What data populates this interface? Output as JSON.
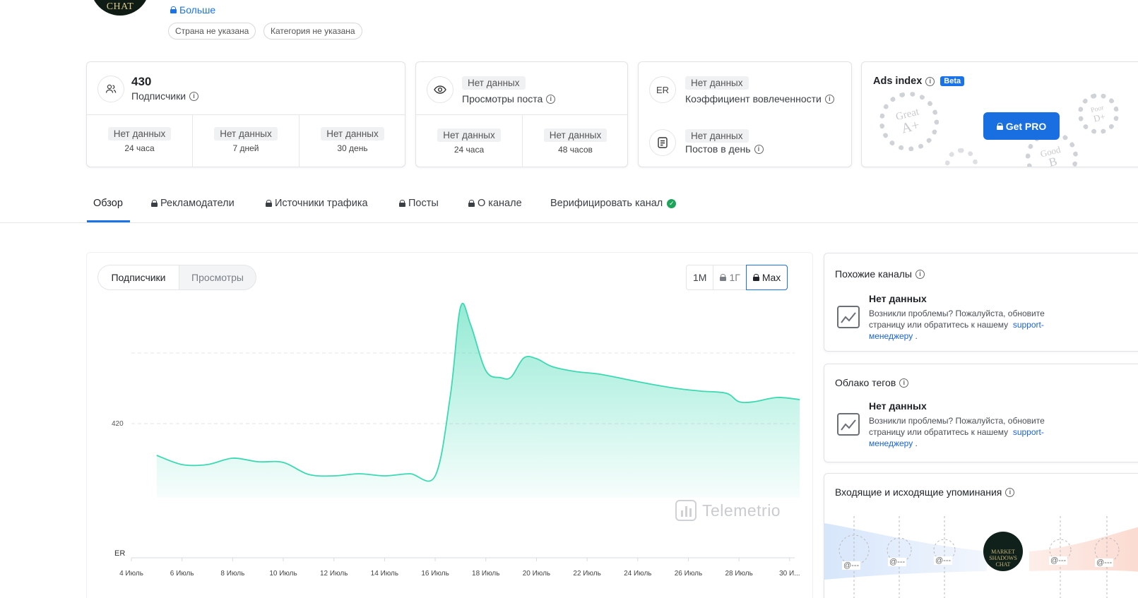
{
  "header": {
    "avatar_text": "CHAT",
    "more_link": "Больше",
    "tags": [
      "Страна не указана",
      "Категория не указана"
    ]
  },
  "subscribers_card": {
    "value": "430",
    "label": "Подписчики",
    "periods": [
      {
        "value": "Нет данных",
        "label": "24 часа"
      },
      {
        "value": "Нет данных",
        "label": "7 дней"
      },
      {
        "value": "Нет данных",
        "label": "30 день"
      }
    ]
  },
  "views_card": {
    "value": "Нет данных",
    "label": "Просмотры поста",
    "periods": [
      {
        "value": "Нет данных",
        "label": "24 часа"
      },
      {
        "value": "Нет данных",
        "label": "48 часов"
      }
    ]
  },
  "engagement_card": {
    "er_icon_text": "ER",
    "er_value": "Нет данных",
    "er_label": "Коэффициент вовлеченности",
    "posts_value": "Нет данных",
    "posts_label": "Постов в день"
  },
  "ads_card": {
    "title": "Ads index",
    "beta": "Beta",
    "button": "Get PRO",
    "badges": [
      {
        "word": "Great",
        "grade": "A+"
      },
      {
        "word": "Good",
        "grade": "B"
      },
      {
        "word": "Poor",
        "grade": "D+"
      }
    ]
  },
  "tabs": [
    {
      "label": "Обзор",
      "locked": false
    },
    {
      "label": "Рекламодатели",
      "locked": true
    },
    {
      "label": "Источники трафика",
      "locked": true
    },
    {
      "label": "Посты",
      "locked": true
    },
    {
      "label": "О канале",
      "locked": true
    },
    {
      "label": "Верифицировать канал",
      "locked": false
    }
  ],
  "chart_controls": {
    "toggle": [
      "Подписчики",
      "Просмотры"
    ],
    "ranges": [
      "1M",
      "1Г",
      "Max"
    ],
    "selected_range": "Max",
    "watermark": "Telemetrio"
  },
  "chart_data": {
    "type": "area",
    "ylabel": "ER",
    "y_tick": "420",
    "ylim": [
      410,
      436
    ],
    "x_ticks": [
      "4 Июль",
      "6 Июль",
      "8 Июль",
      "10 Июль",
      "12 Июль",
      "14 Июль",
      "16 Июль",
      "18 Июль",
      "20 Июль",
      "22 Июль",
      "24 Июль",
      "26 Июль",
      "28 Июль",
      "30 И..."
    ],
    "x": [
      5,
      6,
      7,
      8,
      9,
      10,
      11,
      12,
      13,
      14,
      15,
      16,
      16.6,
      17,
      17.4,
      18,
      18.6,
      19,
      19.5,
      20,
      20.6,
      21.5,
      22.5,
      23.5,
      24.5,
      25.5,
      26.5,
      27.5,
      28,
      28.6,
      29.5,
      30.4
    ],
    "values": [
      415.5,
      414.2,
      414.2,
      415.1,
      414.6,
      414.5,
      412.8,
      412.6,
      412.9,
      412.6,
      412.9,
      412.6,
      424,
      436.5,
      434,
      427.5,
      426.5,
      426.6,
      429.3,
      429.2,
      428.1,
      427.4,
      427,
      426.3,
      425.6,
      425,
      424.6,
      424.3,
      423.1,
      423.1,
      423.7,
      423.4
    ],
    "color": "#3dd9b2"
  },
  "similar_channels": {
    "title": "Похожие каналы",
    "nodata": "Нет данных",
    "text": "Возникли проблемы? Пожалуйста, обновите страницу или обратитесь к нашему",
    "link": "support-менеджеру",
    "tail": "."
  },
  "tag_cloud": {
    "title": "Облако тегов",
    "nodata": "Нет данных",
    "text": "Возникли проблемы? Пожалуйста, обновите страницу или обратитесь к нашему",
    "link": "support-менеджеру",
    "tail": "."
  },
  "mentions": {
    "title": "Входящие и исходящие упоминания",
    "placeholder": "@---",
    "center_avatar": "MARKET SHADOWS CHAT"
  }
}
